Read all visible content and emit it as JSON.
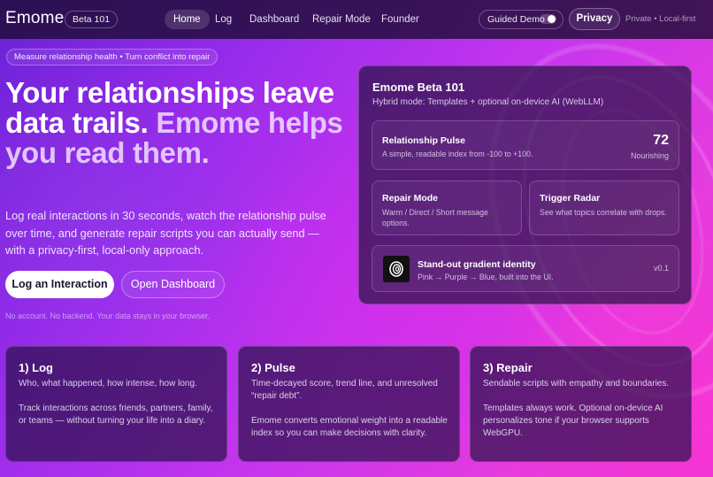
{
  "nav": {
    "brand": "Emome",
    "beta_badge": "Beta 101",
    "links": [
      "Home",
      "Log",
      "Dashboard",
      "Repair Mode",
      "Founder"
    ],
    "active_link": "Home",
    "guided_demo_label": "Guided Demo",
    "guided_demo_on": false,
    "privacy_label": "Privacy",
    "privacy_note": "Private • Local-first"
  },
  "hero": {
    "tagline": "Measure relationship health • Turn conflict into repair",
    "title_line1": "Your relationships leave data trails.",
    "title_line2": "Emome helps you read them.",
    "subtitle": "Log real interactions in 30 seconds, watch the relationship pulse over time, and generate repair scripts you can actually send — with a privacy-first, local-only approach.",
    "primary_cta": "Log an Interaction",
    "secondary_cta": "Open Dashboard",
    "fineprint": "No account. No backend. Your data stays in your browser."
  },
  "panel": {
    "title": "Emome Beta 101",
    "subtitle": "Hybrid mode: Templates + optional on-device AI (WebLLM)",
    "pulse": {
      "title": "Relationship Pulse",
      "desc": "A simple, readable index from -100 to +100.",
      "value": "72",
      "state": "Nourishing"
    },
    "repair": {
      "title": "Repair Mode",
      "desc": "Warm / Direct / Short message options."
    },
    "radar": {
      "title": "Trigger Radar",
      "desc": "See what topics correlate with drops."
    },
    "identity": {
      "title": "Stand-out gradient identity",
      "desc": "Pink → Purple → Blue, built into the UI.",
      "version": "v0.1"
    }
  },
  "features": [
    {
      "title": "1) Log",
      "desc1": "Who, what happened, how intense, how long.",
      "desc2": "Track interactions across friends, partners, family, or teams — without turning your life into a diary."
    },
    {
      "title": "2) Pulse",
      "desc1": "Time-decayed score, trend line, and unresolved “repair debt”.",
      "desc2": "Emome converts emotional weight into a readable index so you can make decisions with clarity."
    },
    {
      "title": "3) Repair",
      "desc1": "Sendable scripts with empathy and boundaries.",
      "desc2": "Templates always work. Optional on-device AI personalizes tone if your browser supports WebGPU."
    }
  ]
}
